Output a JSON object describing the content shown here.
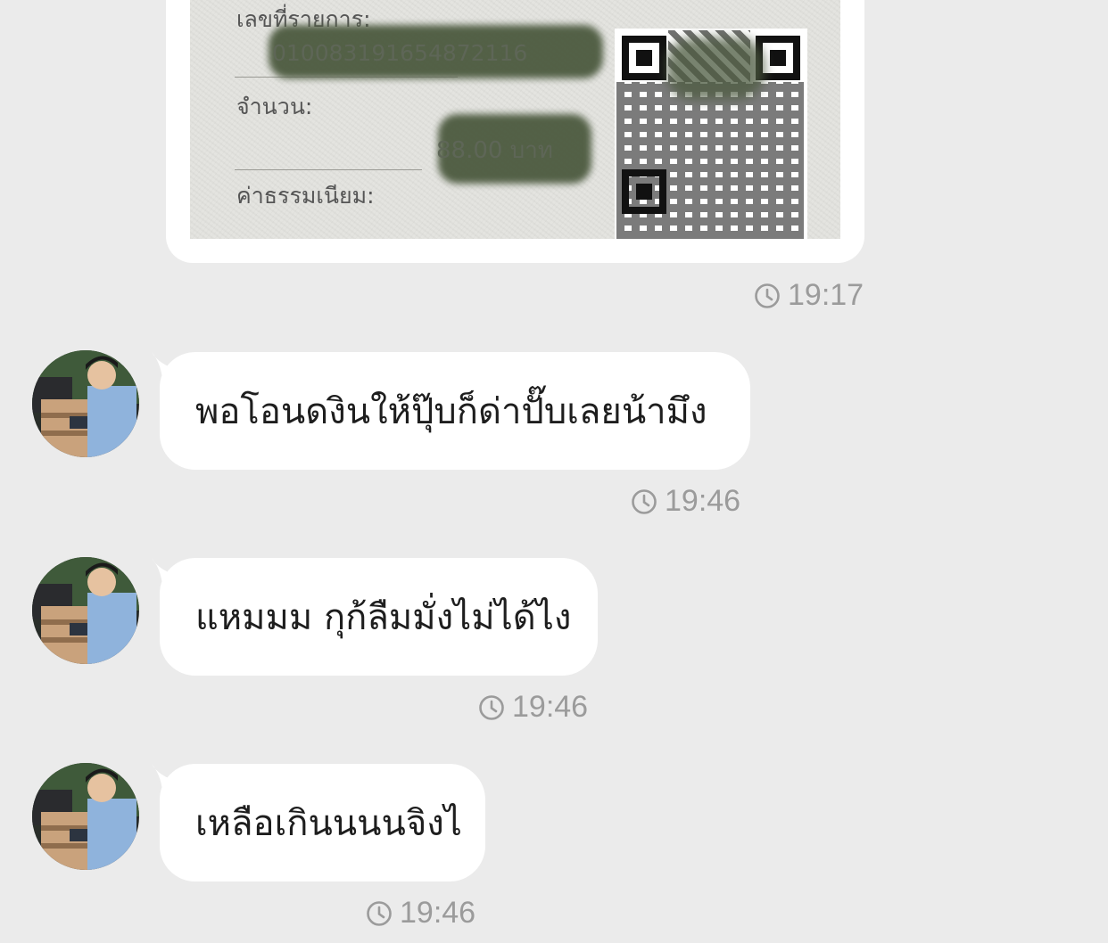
{
  "receipt": {
    "label_ref": "เลขที่รายการ:",
    "value_ref": "010083191654872116",
    "label_amount": "จำนวน:",
    "value_amount": "88.00 บาท",
    "label_fee": "ค่าธรรมเนียม:",
    "time": "19:17"
  },
  "messages": [
    {
      "text": "พอโอนดงินให้ปุ๊บก็ด่าปั๊บเลยน้ามึง",
      "time": "19:46"
    },
    {
      "text": "แหมมม กุก้ลืมมั่งไม่ได้ไง",
      "time": "19:46"
    },
    {
      "text": "เหลือเกินนนนจิงไ",
      "time": "19:46"
    }
  ],
  "colors": {
    "background": "#ebebeb",
    "bubble": "#ffffff",
    "timestamp": "#9b9b9b"
  },
  "icons": {
    "clock": "clock-icon",
    "avatar": "avatar"
  }
}
